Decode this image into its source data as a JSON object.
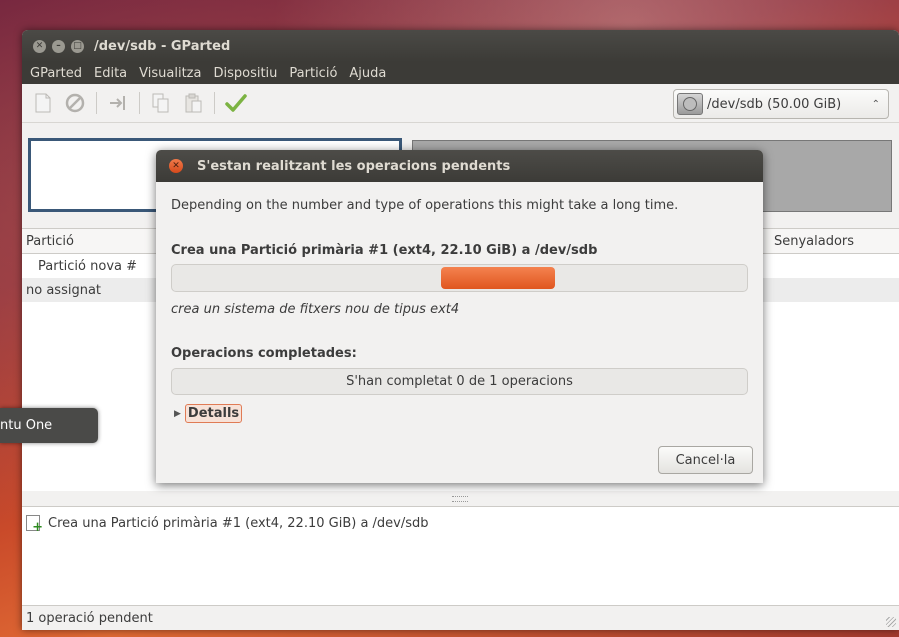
{
  "window": {
    "title": "/dev/sdb - GParted"
  },
  "menubar": {
    "items": [
      "GParted",
      "Edita",
      "Visualitza",
      "Dispositiu",
      "Partició",
      "Ajuda"
    ]
  },
  "toolbar": {
    "icons": [
      "new-partition-icon",
      "delete-icon",
      "resize-move-icon",
      "copy-icon",
      "paste-icon",
      "apply-icon"
    ],
    "device": "/dev/sdb  (50.00 GiB)"
  },
  "partition_list": {
    "headers": {
      "partition": "Partició",
      "flags": "Senyaladors"
    },
    "rows": [
      {
        "partition": "Partició nova #"
      },
      {
        "partition": "no assignat"
      }
    ]
  },
  "pending": {
    "operations": [
      "Crea una Partició primària #1 (ext4, 22.10 GiB) a /dev/sdb"
    ],
    "status": "1 operació pendent"
  },
  "tooltip": {
    "text": "ntu One"
  },
  "dialog": {
    "title": "S'estan realitzant les operacions pendents",
    "description": "Depending on the number and type of operations this might take a long time.",
    "current_operation": "Crea una Partició primària #1 (ext4, 22.10 GiB) a /dev/sdb",
    "sub_operation": "crea un sistema de fitxers nou de tipus ext4",
    "completed_label": "Operacions completades:",
    "completed_text": "S'han completat 0 de 1 operacions",
    "completed_fraction": 0,
    "details_label": "Detalls",
    "cancel_label": "Cancel·la"
  },
  "colors": {
    "accent": "#e0561f",
    "titlebar": "#3c3b37",
    "selection_border": "#3a5878"
  }
}
